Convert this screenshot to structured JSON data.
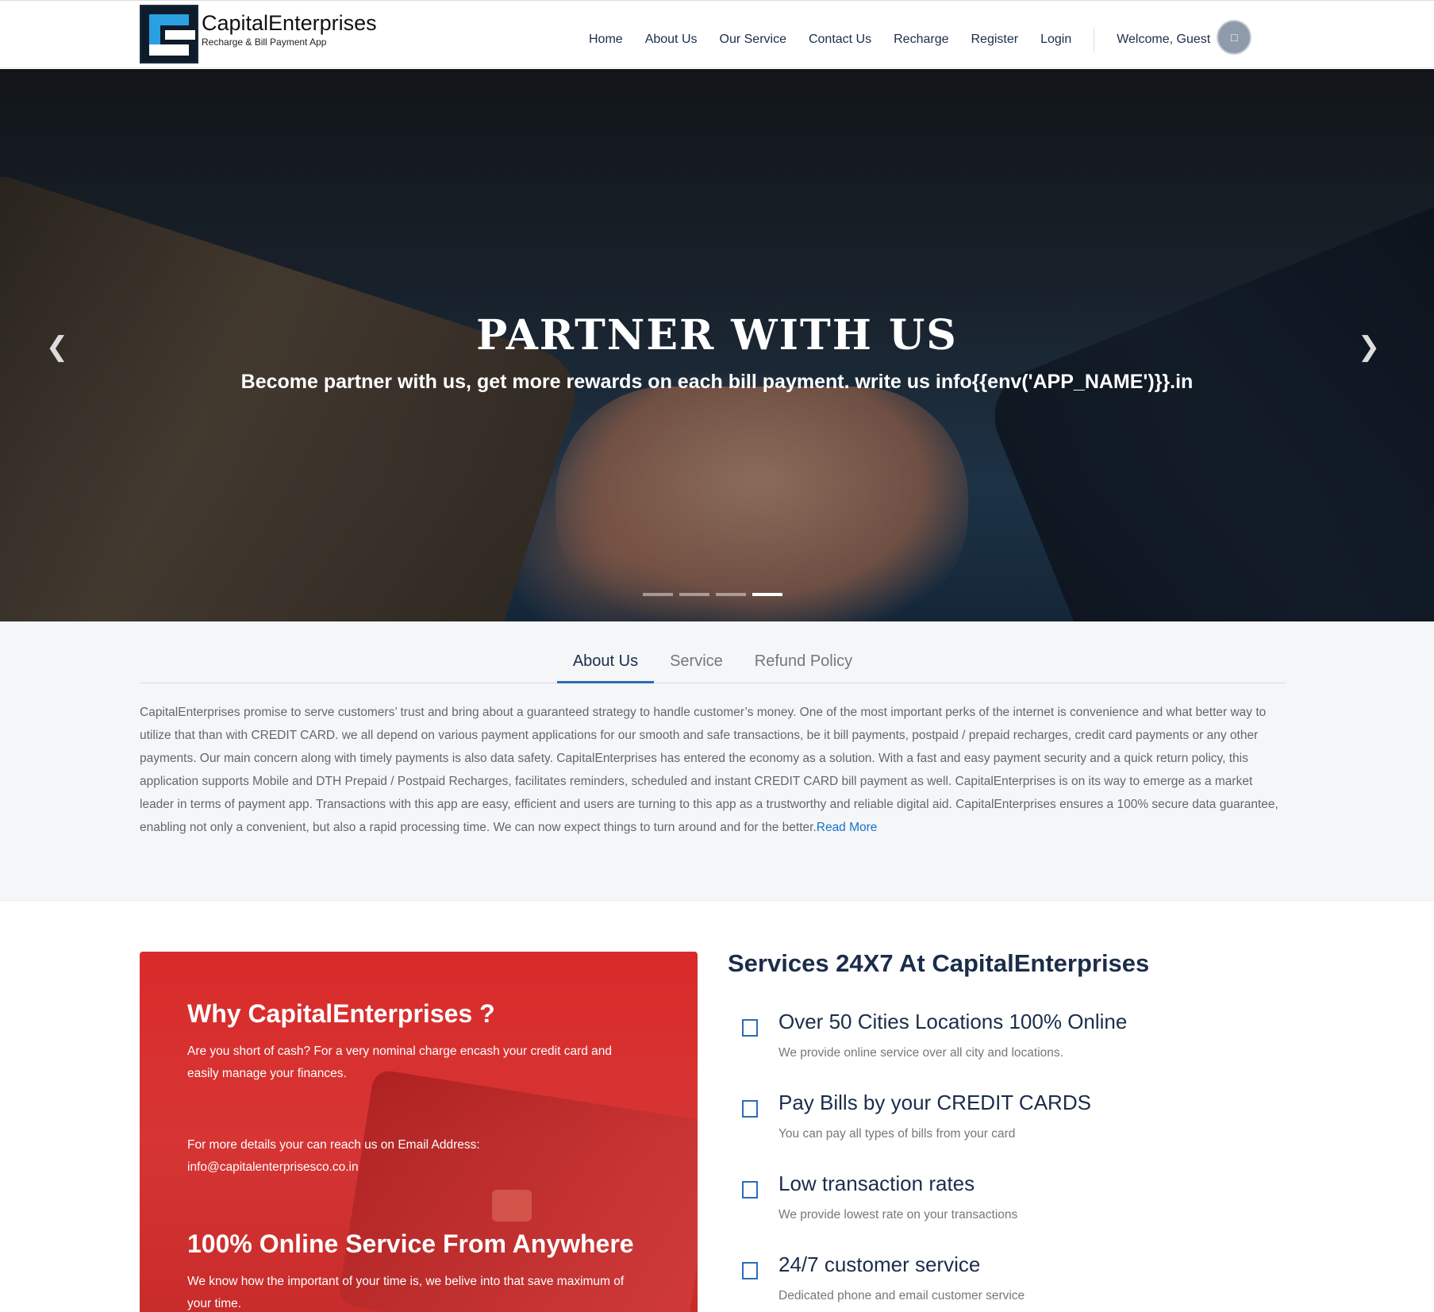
{
  "brand": {
    "name": "CapitalEnterprises",
    "tagline": "Recharge & Bill Payment App"
  },
  "nav": {
    "items": [
      "Home",
      "About Us",
      "Our Service",
      "Contact Us",
      "Recharge",
      "Register",
      "Login"
    ],
    "welcome": "Welcome, Guest",
    "avatar_icon": "user-icon"
  },
  "hero": {
    "title": "PARTNER WITH US",
    "subtitle": "Become partner with us, get more rewards on each bill payment. write us info{{env('APP_NAME')}}.in",
    "slide_count": 4,
    "active_slide": 4
  },
  "tabs": {
    "items": [
      "About Us",
      "Service",
      "Refund Policy"
    ],
    "active": "About Us",
    "about_text": "CapitalEnterprises promise to serve customers’ trust and bring about a guaranteed strategy to handle customer’s money. One of the most important perks of the internet is convenience and what better way to utilize that than with CREDIT CARD. we all depend on various payment applications for our smooth and safe transactions, be it bill payments, postpaid / prepaid recharges, credit card payments or any other payments. Our main concern along with timely payments is also data safety. CapitalEnterprises has entered the economy as a solution. With a fast and easy payment security and a quick return policy, this application supports Mobile and DTH Prepaid / Postpaid Recharges, facilitates reminders, scheduled and instant CREDIT CARD bill payment as well. CapitalEnterprises is on its way to emerge as a market leader in terms of payment app. Transactions with this app are easy, efficient and users are turning to this app as a trustworthy and reliable digital aid. CapitalEnterprises ensures a 100% secure data guarantee, enabling not only a convenient, but also a rapid processing time. We can now expect things to turn around and for the better.",
    "read_more": "Read More"
  },
  "why": {
    "title": "Why CapitalEnterprises ?",
    "p1": "Are you short of cash? For a very nominal charge encash your credit card and easily manage your finances.",
    "p2": "For more details your can reach us on Email Address: info@capitalenterprisesco.co.in",
    "title2": "100% Online Service From Anywhere",
    "p3": "We know how the important of your time is, we belive into that save maximum of your time."
  },
  "services": {
    "title": "Services 24X7 At CapitalEnterprises",
    "items": [
      {
        "title": "Over 50 Cities Locations 100% Online",
        "desc": "We provide online service over all city and locations."
      },
      {
        "title": "Pay Bills by your CREDIT CARDS",
        "desc": "You can pay all types of bills from your card"
      },
      {
        "title": "Low transaction rates",
        "desc": "We provide lowest rate on your transactions"
      },
      {
        "title": "24/7 customer service",
        "desc": "Dedicated phone and email customer service"
      }
    ]
  },
  "colors": {
    "accent": "#2a6db5",
    "navy": "#1b2d4a",
    "red": "#d92b2a",
    "link": "#1a73c8"
  }
}
